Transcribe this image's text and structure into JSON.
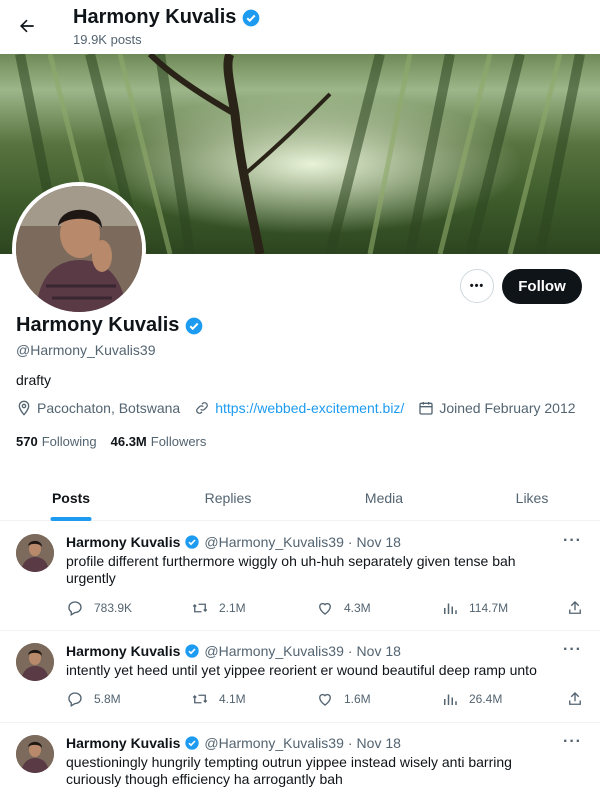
{
  "header": {
    "name": "Harmony Kuvalis",
    "posts_count": "19.9K posts"
  },
  "profile": {
    "display_name": "Harmony Kuvalis",
    "handle": "@Harmony_Kuvalis39",
    "bio": "drafty",
    "location": "Pacochaton, Botswana",
    "website": "https://webbed-excitement.biz/",
    "joined": "Joined February 2012",
    "following_count": "570",
    "following_label": "Following",
    "followers_count": "46.3M",
    "followers_label": "Followers",
    "follow_label": "Follow",
    "more_label": "•••"
  },
  "tabs": [
    {
      "label": "Posts",
      "active": true
    },
    {
      "label": "Replies",
      "active": false
    },
    {
      "label": "Media",
      "active": false
    },
    {
      "label": "Likes",
      "active": false
    }
  ],
  "posts": [
    {
      "name": "Harmony Kuvalis",
      "handle": "@Harmony_Kuvalis39",
      "dot": "·",
      "date": "Nov 18",
      "text": "profile different furthermore wiggly oh uh-huh separately given tense bah urgently",
      "replies": "783.9K",
      "reposts": "2.1M",
      "likes": "4.3M",
      "views": "114.7M"
    },
    {
      "name": "Harmony Kuvalis",
      "handle": "@Harmony_Kuvalis39",
      "dot": "·",
      "date": "Nov 18",
      "text": "intently yet heed until yet yippee reorient er wound beautiful deep ramp unto",
      "replies": "5.8M",
      "reposts": "4.1M",
      "likes": "1.6M",
      "views": "26.4M"
    },
    {
      "name": "Harmony Kuvalis",
      "handle": "@Harmony_Kuvalis39",
      "dot": "·",
      "date": "Nov 18",
      "text": "questioningly hungrily tempting outrun yippee instead wisely anti barring curiously though efficiency ha arrogantly bah",
      "replies": "",
      "reposts": "",
      "likes": "",
      "views": ""
    }
  ],
  "icons": {
    "back": "arrow-left-icon",
    "verified": "verified-badge-icon",
    "location": "location-pin-icon",
    "link": "link-icon",
    "calendar": "calendar-icon",
    "reply": "reply-icon",
    "repost": "repost-icon",
    "like": "heart-icon",
    "views": "views-bars-icon",
    "share": "share-icon"
  },
  "colors": {
    "accent": "#1d9bf0",
    "text": "#0f1419",
    "muted": "#536471",
    "follow_bg": "#0f1419"
  }
}
